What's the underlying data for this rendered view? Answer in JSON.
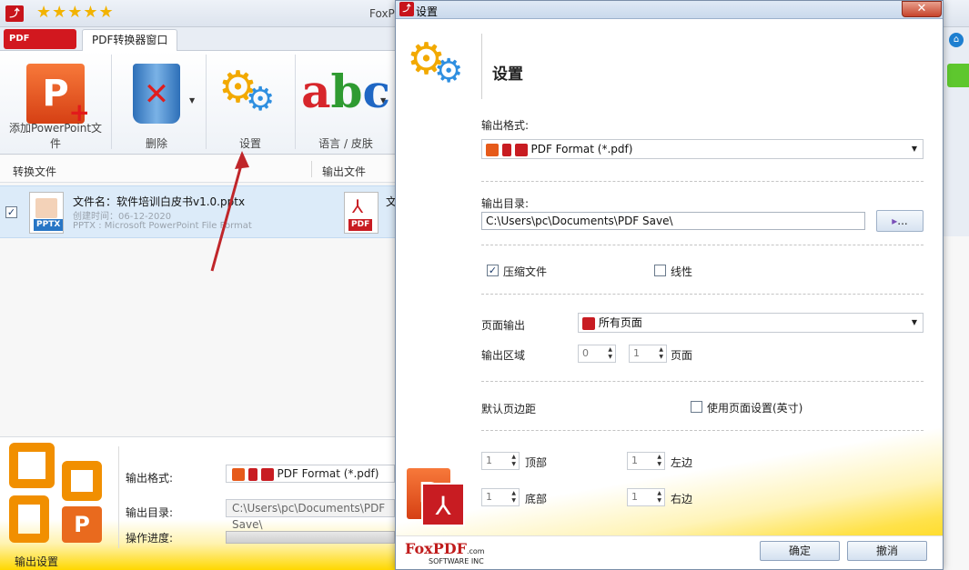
{
  "app": {
    "title": "FoxP",
    "stars": "★★★★★",
    "logo_tab": "PDF",
    "tab_label": "PDF转换器窗口"
  },
  "ribbon": {
    "add_label": "添加PowerPoint文件",
    "delete_label": "删除",
    "settings_label": "设置",
    "lang_label": "语言 / 皮肤"
  },
  "columns": {
    "convert": "转换文件",
    "output": "输出文件"
  },
  "file": {
    "name": "文件名：软件培训白皮书v1.0.pptx",
    "created": "创建时间：06-12-2020",
    "format": "PPTX : Microsoft PowerPoint File Format",
    "src_tag": "PPTX",
    "dst_tag": "PDF",
    "dst_name": "文",
    "checked": true
  },
  "bottom": {
    "section_label": "输出设置",
    "format_label": "输出格式:",
    "format_value": "PDF Format (*.pdf)",
    "dir_label": "输出目录:",
    "dir_value": "C:\\Users\\pc\\Documents\\PDF Save\\",
    "progress_label": "操作进度:",
    "progress": 0
  },
  "dialog": {
    "title": "设置",
    "header": "设置",
    "output_format_label": "输出格式:",
    "output_format_value": "PDF Format (*.pdf)",
    "output_dir_label": "输出目录:",
    "output_dir_value": "C:\\Users\\pc\\Documents\\PDF Save\\",
    "browse_label": "...",
    "compress_label": "压缩文件",
    "compress_checked": true,
    "linear_label": "线性",
    "linear_checked": false,
    "page_output_label": "页面输出",
    "page_output_value": "所有页面",
    "output_range_label": "输出区域",
    "range_from": "0",
    "range_to": "1",
    "range_unit": "页面",
    "margins_label": "默认页边距",
    "use_page_settings_label": "使用页面设置(英寸)",
    "use_page_settings_checked": false,
    "top_value": "1",
    "top_label": "顶部",
    "left_value": "1",
    "left_label": "左边",
    "bottom_value": "1",
    "bottom_label": "底部",
    "right_value": "1",
    "right_label": "右边",
    "ok_label": "确定",
    "cancel_label": "撤消",
    "brand": "FoxPDF",
    "brand_com": ".com",
    "brand_sub": "SOFTWARE INC"
  },
  "colors": {
    "accent_red": "#c8141b",
    "yellow": "#ffd800",
    "selection": "#dcebf9"
  }
}
